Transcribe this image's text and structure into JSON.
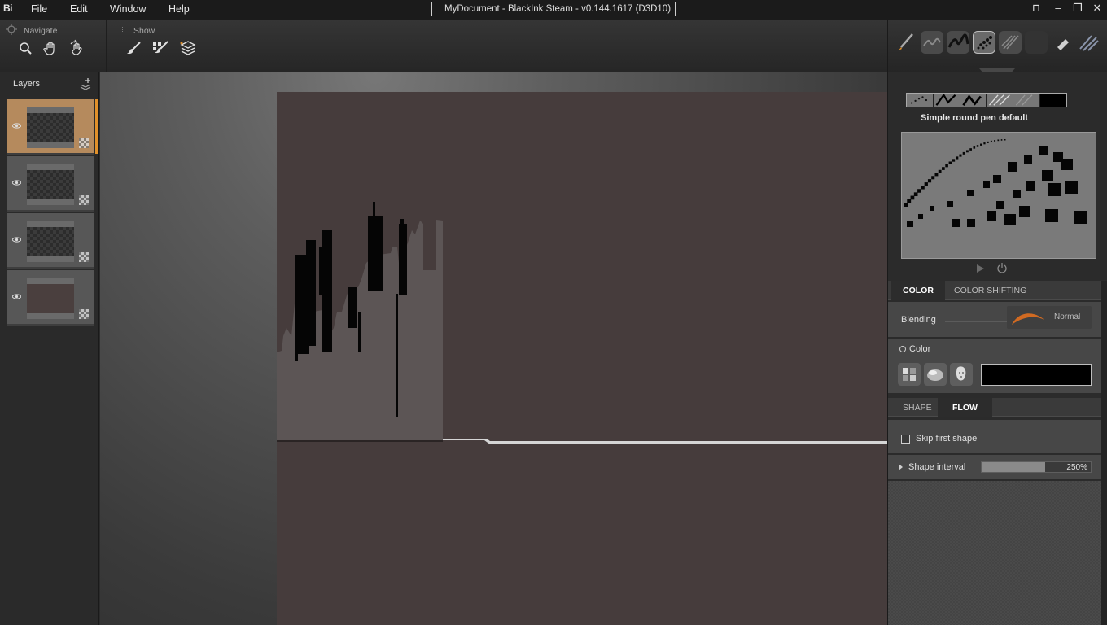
{
  "app": {
    "logo": "Bi",
    "window_title": "MyDocument - BlackInk Steam - v0.144.1617 (D3D10)"
  },
  "menu": [
    {
      "label": "File"
    },
    {
      "label": "Edit"
    },
    {
      "label": "Window"
    },
    {
      "label": "Help"
    }
  ],
  "window_controls": {
    "restore": "⊓",
    "minimize": "–",
    "maximize": "❐",
    "close": "✕"
  },
  "toolbar": {
    "navigate": {
      "label": "Navigate",
      "icons": [
        "zoom-icon",
        "pan-hand-icon",
        "rotate-hand-icon"
      ]
    },
    "show": {
      "label": "Show",
      "icons": [
        "brush-show-icon",
        "grid-brush-icon",
        "layers-stack-icon"
      ]
    }
  },
  "brushes": [
    {
      "icon": "pen-brush-icon",
      "selected": false
    },
    {
      "icon": "scribble-brush-icon",
      "selected": false
    },
    {
      "icon": "ink-brush-icon",
      "selected": false
    },
    {
      "icon": "dots-brush-icon",
      "selected": true
    },
    {
      "icon": "hatch-brush-icon",
      "selected": false
    },
    {
      "icon": "empty-brush-icon",
      "selected": false
    },
    {
      "icon": "eraser-brush-icon",
      "selected": false
    },
    {
      "icon": "strokes-brush-icon",
      "selected": false
    }
  ],
  "layers": {
    "title": "Layers",
    "items": [
      {
        "name": "layer-1",
        "content": "checker",
        "active": true
      },
      {
        "name": "layer-2",
        "content": "checker",
        "active": false
      },
      {
        "name": "layer-3",
        "content": "checker",
        "active": false
      },
      {
        "name": "layer-4",
        "content": "fill",
        "active": false
      }
    ]
  },
  "brush_panel": {
    "name": "Simple round pen default",
    "swatch_count": 6
  },
  "color_tabs": {
    "tabs": [
      {
        "label": "COLOR",
        "active": true
      },
      {
        "label": "COLOR SHIFTING",
        "active": false
      }
    ]
  },
  "blending": {
    "label": "Blending",
    "value": "Normal"
  },
  "color": {
    "label": "Color",
    "value": "#000000",
    "pickers": [
      "palette-icon",
      "sphere-icon",
      "face-icon"
    ]
  },
  "shape_tabs": {
    "tabs": [
      {
        "label": "SHAPE",
        "active": false
      },
      {
        "label": "FLOW",
        "active": true
      }
    ]
  },
  "flow": {
    "skip_first_shape": {
      "label": "Skip first shape",
      "checked": false
    },
    "shape_interval": {
      "label": "Shape interval",
      "value": "250%",
      "fraction": 0.58
    }
  },
  "colors": {
    "accent": "#e0902a",
    "active_layer": "#b58a5d",
    "document_bg": "#463c3c"
  }
}
